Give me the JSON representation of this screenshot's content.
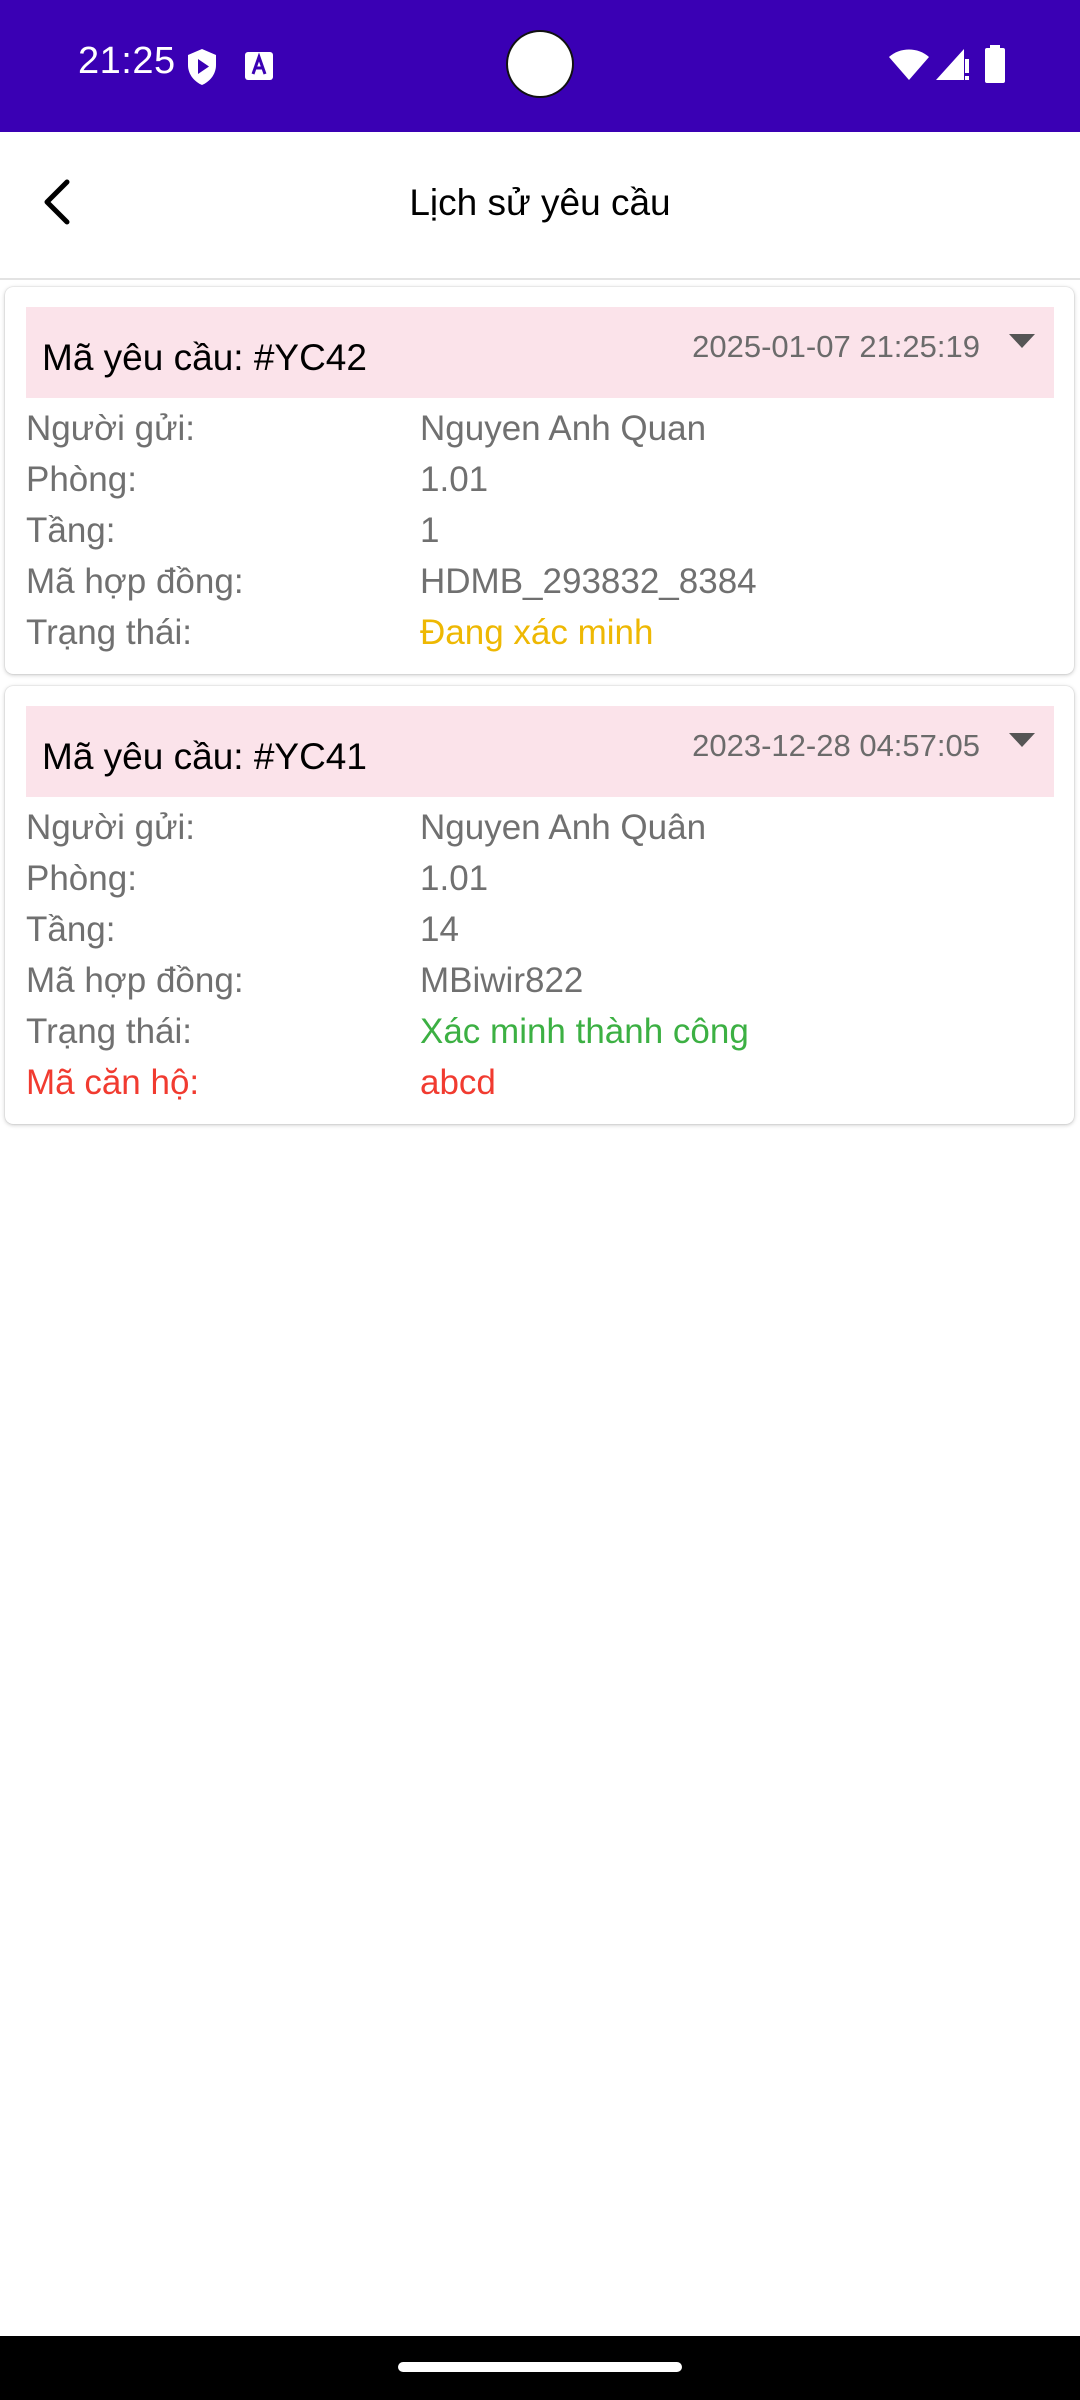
{
  "status_bar": {
    "time": "21:25",
    "icons": [
      "shield-play-icon",
      "text-a-icon",
      "wifi-icon",
      "signal-icon",
      "battery-icon"
    ]
  },
  "app_bar": {
    "title": "Lịch sử yêu cầu",
    "back_icon": "chevron-left-icon"
  },
  "colors": {
    "status_bar": "#3a00b4",
    "card_header": "#fbe3ea",
    "label_gray": "#707070",
    "pending_yellow": "#eeb803",
    "success_green": "#3cb043",
    "error_red": "#f13b30"
  },
  "requests": [
    {
      "code": "Mã yêu cầu: #YC42",
      "date": "2025-01-07 21:25:19",
      "fields": [
        {
          "label": "Người gửi:",
          "value": "Nguyen Anh Quan"
        },
        {
          "label": "Phòng:",
          "value": "1.01"
        },
        {
          "label": "Tầng:",
          "value": "1"
        },
        {
          "label": "Mã hợp đồng:",
          "value": "HDMB_293832_8384"
        },
        {
          "label": "Trạng thái:",
          "value": "Đang xác minh"
        }
      ]
    },
    {
      "code": "Mã yêu cầu: #YC41",
      "date": "2023-12-28 04:57:05",
      "fields": [
        {
          "label": "Người gửi:",
          "value": "Nguyen Anh Quân"
        },
        {
          "label": "Phòng:",
          "value": "1.01"
        },
        {
          "label": "Tầng:",
          "value": "14"
        },
        {
          "label": "Mã hợp đồng:",
          "value": "MBiwir822"
        },
        {
          "label": "Trạng thái:",
          "value": "Xác minh thành công"
        },
        {
          "label": "Mã căn hộ:",
          "value": "abcd"
        }
      ]
    }
  ]
}
